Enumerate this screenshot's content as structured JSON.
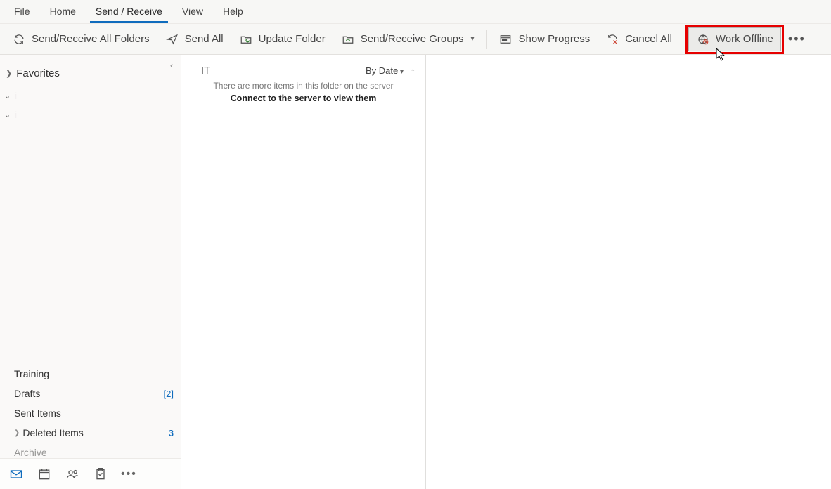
{
  "tabs": {
    "file": "File",
    "home": "Home",
    "send_receive": "Send / Receive",
    "view": "View",
    "help": "Help",
    "active": "send_receive"
  },
  "ribbon": {
    "send_receive_all": "Send/Receive All Folders",
    "send_all": "Send All",
    "update_folder": "Update Folder",
    "send_receive_groups": "Send/Receive Groups",
    "show_progress": "Show Progress",
    "cancel_all": "Cancel All",
    "work_offline": "Work Offline"
  },
  "nav": {
    "favorites": "Favorites",
    "folders": {
      "training": "Training",
      "drafts": "Drafts",
      "drafts_count": "[2]",
      "sent": "Sent Items",
      "deleted": "Deleted Items",
      "deleted_count": "3",
      "archive": "Archive"
    }
  },
  "list": {
    "folder_title": "IT",
    "sort_label": "By Date",
    "server_msg_line1": "There are more items in this folder on the server",
    "server_msg_line2": "Connect to the server to view them"
  }
}
